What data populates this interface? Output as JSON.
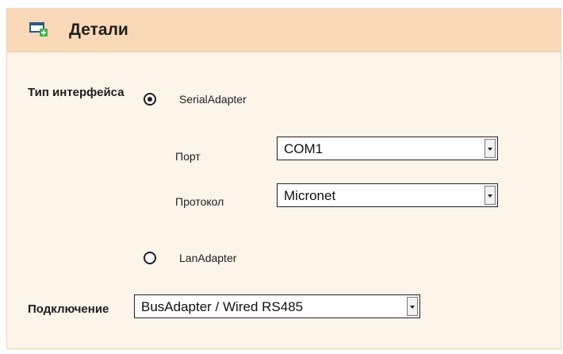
{
  "header": {
    "title": "Детали",
    "icon": "add-window-icon"
  },
  "interface_type": {
    "label": "Тип интерфейса",
    "options": [
      {
        "label": "SerialAdapter",
        "selected": true
      },
      {
        "label": "LanAdapter",
        "selected": false
      }
    ]
  },
  "serial": {
    "port_label": "Порт",
    "port_value": "COM1",
    "protocol_label": "Протокол",
    "protocol_value": "Micronet"
  },
  "connection": {
    "label": "Подключение",
    "value": "BusAdapter / Wired RS485"
  },
  "colors": {
    "header_bg": "#f9d8b7",
    "panel_bg": "#fdf4ea"
  }
}
